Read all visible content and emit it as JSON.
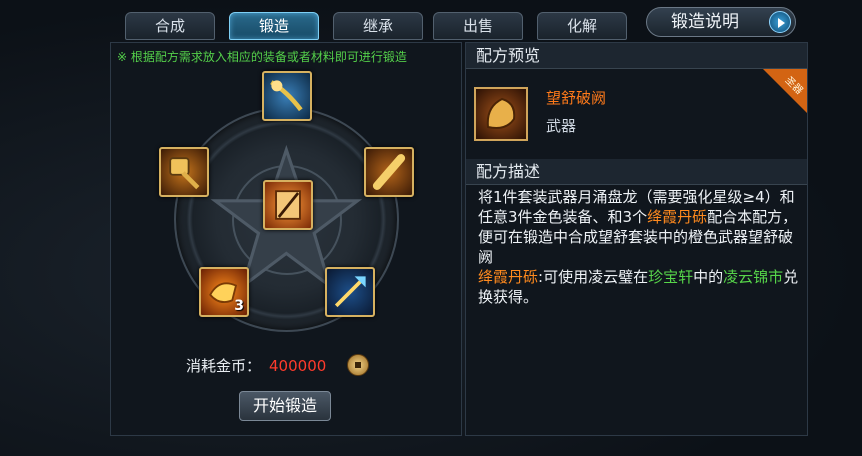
{
  "tabs": [
    {
      "label": "合成",
      "active": false
    },
    {
      "label": "锻造",
      "active": true
    },
    {
      "label": "继承",
      "active": false
    },
    {
      "label": "出售",
      "active": false
    },
    {
      "label": "化解",
      "active": false
    }
  ],
  "help_button": {
    "label": "锻造说明",
    "icon": "play-arrow-icon"
  },
  "forge": {
    "hint": "※ 根据配方需求放入相应的装备或者材料即可进行锻造",
    "slots": [
      {
        "name": "center-slot",
        "icon": "scroll-weapon-icon"
      },
      {
        "name": "top-slot",
        "icon": "dragon-staff-icon"
      },
      {
        "name": "left-slot",
        "icon": "gold-hammer-icon"
      },
      {
        "name": "right-slot",
        "icon": "gold-club-icon"
      },
      {
        "name": "bottom-left-slot",
        "icon": "gem-material-icon",
        "count": "3"
      },
      {
        "name": "bottom-right-slot",
        "icon": "blue-spear-icon"
      }
    ],
    "cost_label": "消耗金币：",
    "cost_value": "400000",
    "coin_icon": "gold-coin-icon",
    "start_button": "开始锻造"
  },
  "preview": {
    "header": "配方预览",
    "item_name": "望舒破阙",
    "item_type": "武器",
    "badge": "圣器",
    "colors": {
      "name": "#ff7a1a",
      "badge": "#d36413"
    }
  },
  "description": {
    "header": "配方描述",
    "line1": "将1件套装武器月涌盘龙（需要强化星级≥4）和任意3件金色装备、和3个",
    "material1": "绛霞丹砾",
    "line2": "配合本配方，便可在锻造中合成望舒套装中的橙色武器望舒破阙",
    "material2": "绛霞丹砾",
    "line3": ":可使用凌云璧在",
    "shop": "珍宝轩",
    "line4": "中的",
    "market": "凌云锦市",
    "line5": "兑换获得。"
  }
}
